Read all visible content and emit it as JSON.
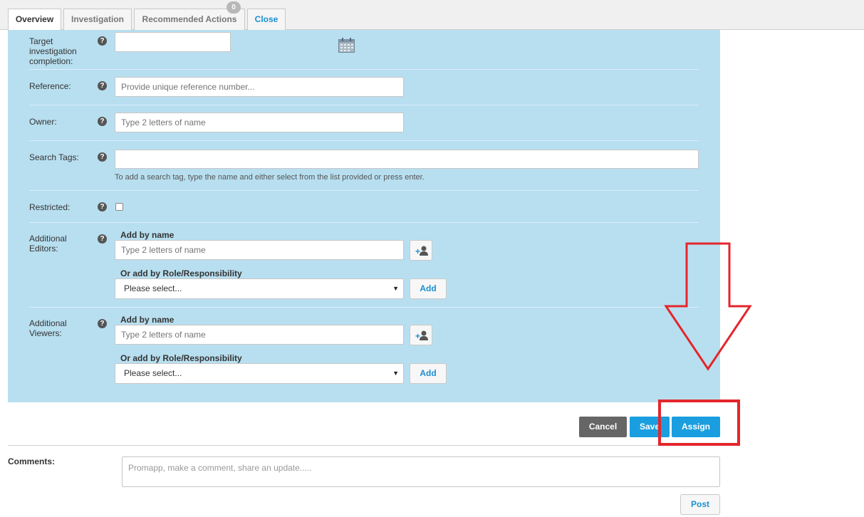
{
  "tabs": [
    {
      "label": "Overview",
      "active": true
    },
    {
      "label": "Investigation"
    },
    {
      "label": "Recommended Actions",
      "badge": "0"
    },
    {
      "label": "Close"
    }
  ],
  "form": {
    "target_label": "Target investigation completion:",
    "target_line1": "Target",
    "target_line2": "investigation",
    "target_line3": "completion:",
    "reference_label": "Reference:",
    "reference_placeholder": "Provide unique reference number...",
    "owner_label": "Owner:",
    "owner_placeholder": "Type 2 letters of name",
    "tags_label": "Search Tags:",
    "tags_hint": "To add a search tag, type the name and either select from the list provided or press enter.",
    "restricted_label": "Restricted:",
    "editors_line1": "Additional",
    "editors_line2": "Editors:",
    "viewers_line1": "Additional",
    "viewers_line2": "Viewers:",
    "add_by_name": "Add by name",
    "name_placeholder": "Type 2 letters of name",
    "add_by_role": "Or add by Role/Responsibility",
    "select_value": "Please select...",
    "add_label": "Add",
    "help_glyph": "?"
  },
  "actions": {
    "cancel": "Cancel",
    "save": "Save",
    "assign": "Assign"
  },
  "comments": {
    "label": "Comments:",
    "placeholder": "Promapp, make a comment, share an update.....",
    "post": "Post"
  },
  "colors": {
    "panel": "#b8dff0",
    "primary_button": "#1a9ee0",
    "cancel_button": "#666666",
    "annotation": "#e3262c"
  },
  "icons": [
    "calendar-icon",
    "add-person-icon",
    "help-icon",
    "dropdown-caret-icon",
    "down-arrow-annotation"
  ]
}
